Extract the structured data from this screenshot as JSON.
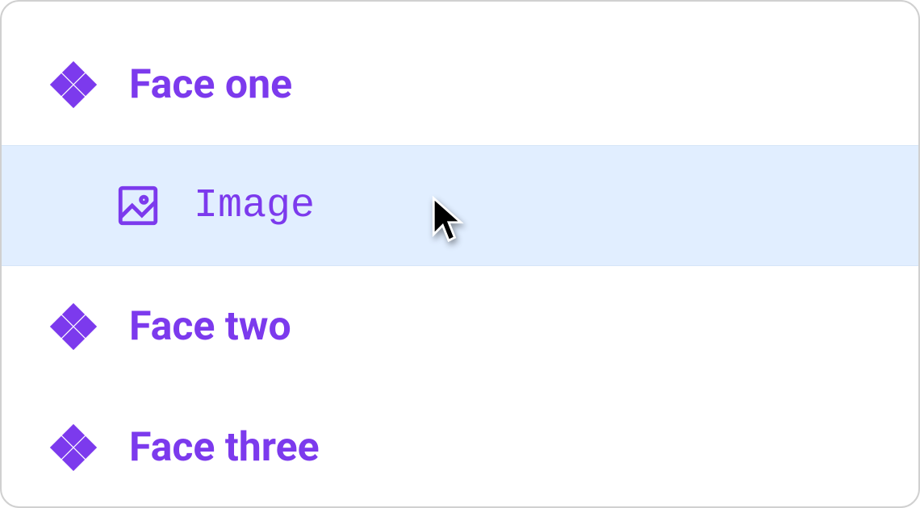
{
  "items": [
    {
      "label": "Face one",
      "kind": "face"
    },
    {
      "label": "Image",
      "kind": "child"
    },
    {
      "label": "Face two",
      "kind": "face"
    },
    {
      "label": "Face three",
      "kind": "face"
    }
  ],
  "colors": {
    "accent": "#7c3aed",
    "hoverBg": "#e1eeff"
  }
}
